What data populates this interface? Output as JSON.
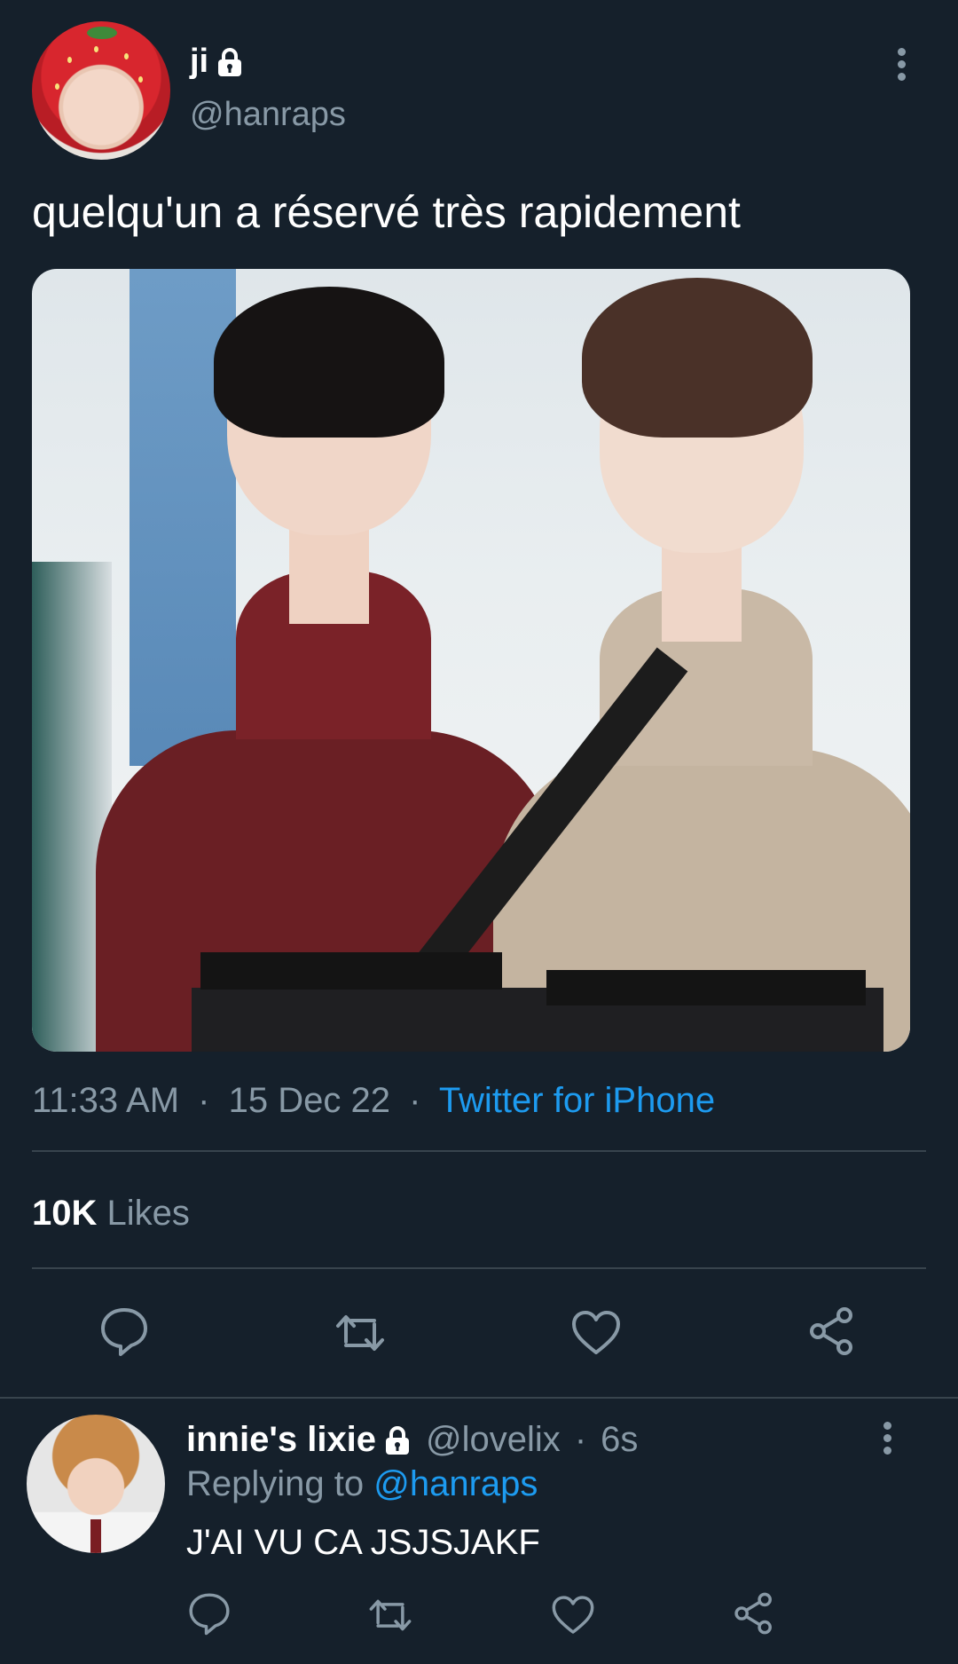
{
  "tweet": {
    "display_name": "ji",
    "handle": "@hanraps",
    "text": "quelqu'un a réservé très rapidement",
    "time": "11:33 AM",
    "separator": "·",
    "date": "15 Dec 22",
    "source": "Twitter for iPhone",
    "likes_count": "10K",
    "likes_label": "Likes"
  },
  "reply": {
    "display_name": "innie's lixie",
    "handle": "@lovelix",
    "separator": "·",
    "age": "6s",
    "replying_prefix": "Replying to",
    "replying_to": "@hanraps",
    "text": "J'AI VU CA JSJSJAKF"
  },
  "colors": {
    "background": "#15202b",
    "secondary_text": "#8899a6",
    "accent": "#1d9bf0",
    "divider": "#38444d"
  },
  "icons": [
    "lock-icon",
    "more-options-icon",
    "reply-icon",
    "retweet-icon",
    "like-icon",
    "share-icon"
  ]
}
